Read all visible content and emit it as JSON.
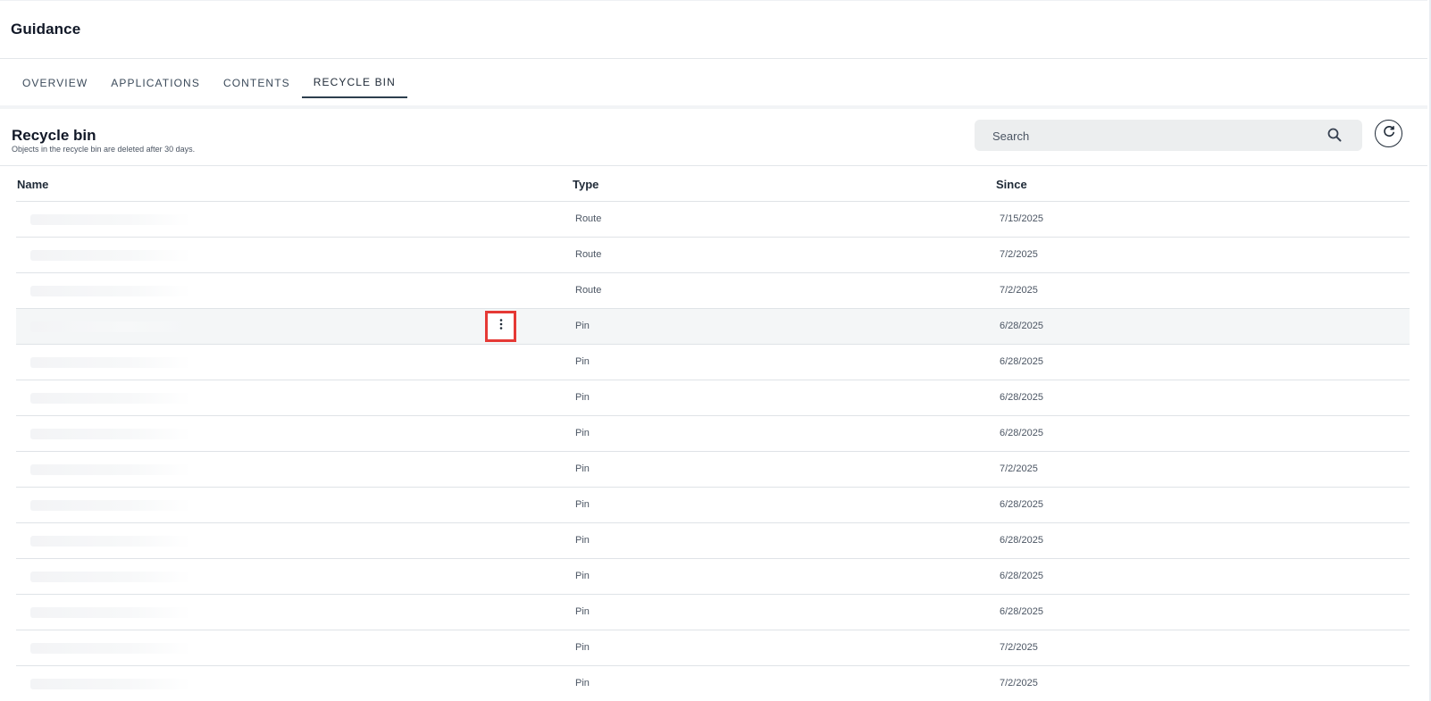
{
  "header": {
    "title": "Guidance"
  },
  "tabs": [
    {
      "label": "OVERVIEW",
      "active": false
    },
    {
      "label": "APPLICATIONS",
      "active": false
    },
    {
      "label": "CONTENTS",
      "active": false
    },
    {
      "label": "RECYCLE BIN",
      "active": true
    }
  ],
  "section": {
    "title": "Recycle bin",
    "subtitle": "Objects in the recycle bin are deleted after 30 days."
  },
  "search": {
    "placeholder": "Search",
    "value": "",
    "icon": "search-icon"
  },
  "refresh": {
    "icon": "refresh-icon"
  },
  "table": {
    "columns": [
      "Name",
      "Type",
      "Since"
    ],
    "rows": [
      {
        "name": "",
        "type": "Route",
        "since": "7/15/2025"
      },
      {
        "name": "",
        "type": "Route",
        "since": "7/2/2025"
      },
      {
        "name": "",
        "type": "Route",
        "since": "7/2/2025"
      },
      {
        "name": "",
        "type": "Pin",
        "since": "6/28/2025",
        "highlighted": true,
        "menu_icon": "more-vertical-icon"
      },
      {
        "name": "",
        "type": "Pin",
        "since": "6/28/2025"
      },
      {
        "name": "",
        "type": "Pin",
        "since": "6/28/2025"
      },
      {
        "name": "",
        "type": "Pin",
        "since": "6/28/2025"
      },
      {
        "name": "",
        "type": "Pin",
        "since": "7/2/2025"
      },
      {
        "name": "",
        "type": "Pin",
        "since": "6/28/2025"
      },
      {
        "name": "",
        "type": "Pin",
        "since": "6/28/2025"
      },
      {
        "name": "",
        "type": "Pin",
        "since": "6/28/2025"
      },
      {
        "name": "",
        "type": "Pin",
        "since": "6/28/2025"
      },
      {
        "name": "",
        "type": "Pin",
        "since": "7/2/2025"
      },
      {
        "name": "",
        "type": "Pin",
        "since": "7/2/2025"
      }
    ]
  },
  "colors": {
    "accent": "#2d3f4e",
    "highlight_border": "#e53935",
    "search_bg": "#eceeef",
    "row_hover": "#f4f6f7"
  }
}
